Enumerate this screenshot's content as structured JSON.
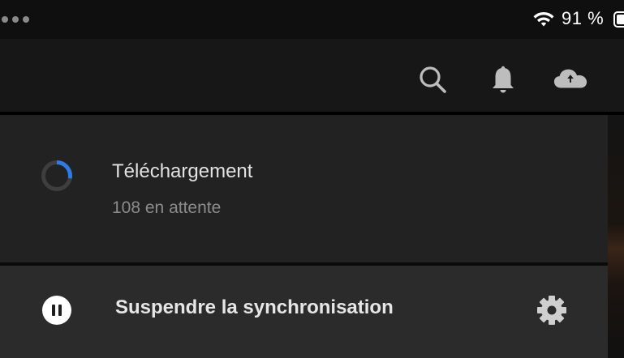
{
  "status_bar": {
    "battery_percent": "91 %",
    "icons": [
      "wifi-icon",
      "battery-icon"
    ]
  },
  "toolbar": {
    "icons": [
      "search-icon",
      "bell-icon",
      "cloud-icon"
    ]
  },
  "download": {
    "title": "Téléchargement",
    "subtitle": "108 en attente",
    "progress": 0.28
  },
  "sync": {
    "label": "Suspendre la synchronisation",
    "icons": [
      "pause-icon",
      "gear-icon"
    ]
  },
  "colors": {
    "accent": "#2f7be6",
    "panel": "#232323",
    "row_highlight": "#2b2b2b"
  }
}
